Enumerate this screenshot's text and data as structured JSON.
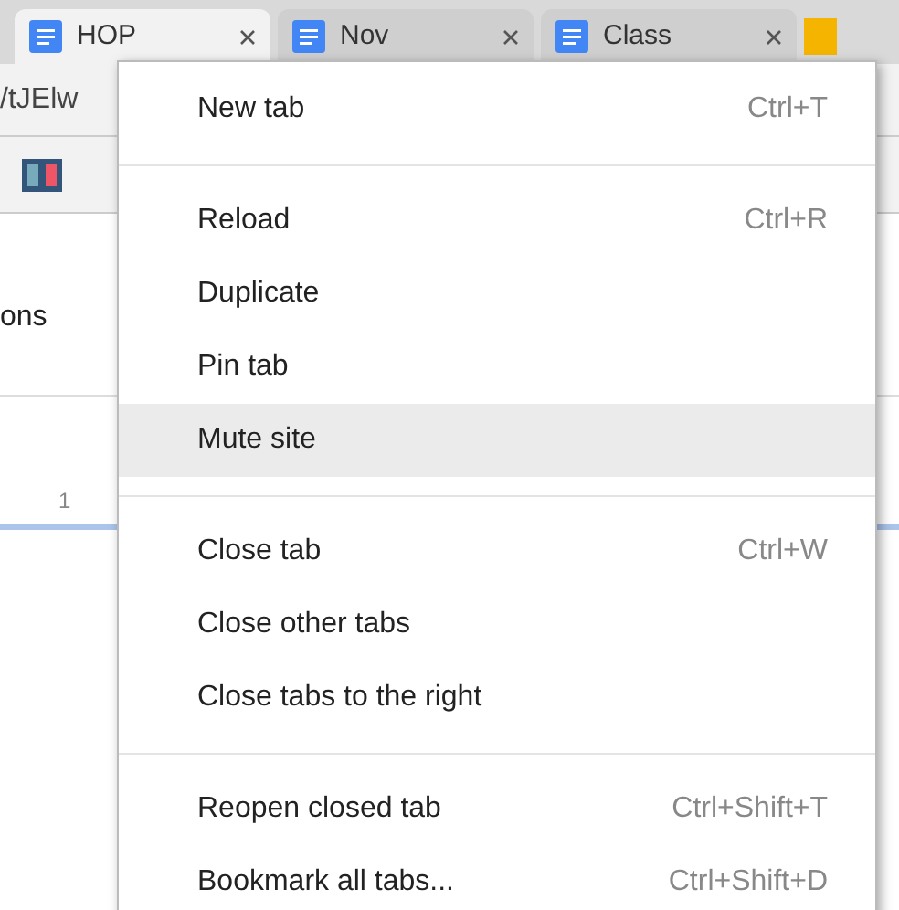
{
  "tabs": [
    {
      "title": "HOP",
      "selected": true
    },
    {
      "title": "Nov",
      "selected": false
    },
    {
      "title": "Class",
      "selected": false
    }
  ],
  "address_bar": {
    "text": "/tJElw"
  },
  "page": {
    "text_1": "ons",
    "ruler_text": "1"
  },
  "context_menu": {
    "items": [
      {
        "kind": "item",
        "label": "New tab",
        "shortcut": "Ctrl+T",
        "highlighted": false
      },
      {
        "kind": "separator"
      },
      {
        "kind": "item",
        "label": "Reload",
        "shortcut": "Ctrl+R",
        "highlighted": false
      },
      {
        "kind": "item",
        "label": "Duplicate",
        "highlighted": false
      },
      {
        "kind": "item",
        "label": "Pin tab",
        "highlighted": false
      },
      {
        "kind": "item",
        "label": "Mute site",
        "highlighted": true
      },
      {
        "kind": "separator"
      },
      {
        "kind": "item",
        "label": "Close tab",
        "shortcut": "Ctrl+W",
        "highlighted": false
      },
      {
        "kind": "item",
        "label": "Close other tabs",
        "highlighted": false
      },
      {
        "kind": "item",
        "label": "Close tabs to the right",
        "highlighted": false
      },
      {
        "kind": "separator"
      },
      {
        "kind": "item",
        "label": "Reopen closed tab",
        "shortcut": "Ctrl+Shift+T",
        "highlighted": false
      },
      {
        "kind": "item",
        "label": "Bookmark all tabs...",
        "shortcut": "Ctrl+Shift+D",
        "highlighted": false
      }
    ]
  }
}
